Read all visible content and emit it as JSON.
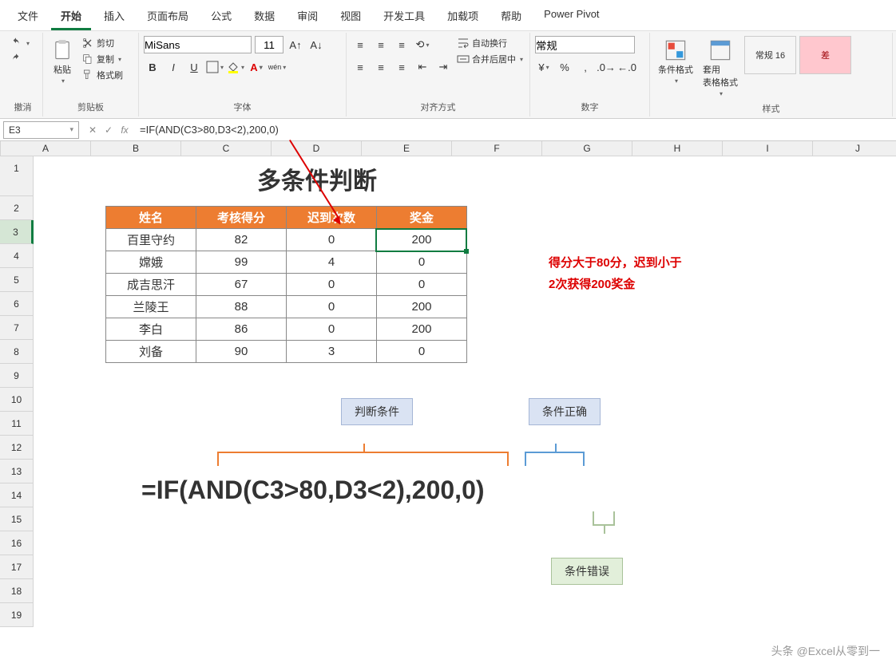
{
  "tabs": [
    "文件",
    "开始",
    "插入",
    "页面布局",
    "公式",
    "数据",
    "审阅",
    "视图",
    "开发工具",
    "加载项",
    "帮助",
    "Power Pivot"
  ],
  "active_tab": 1,
  "ribbon": {
    "undo_label": "撤消",
    "clipboard": {
      "paste": "粘贴",
      "cut": "剪切",
      "copy": "复制",
      "painter": "格式刷",
      "label": "剪贴板"
    },
    "font": {
      "name": "MiSans",
      "size": "11",
      "label": "字体",
      "bold": "B",
      "italic": "I",
      "underline": "U",
      "wen": "wén"
    },
    "align": {
      "label": "对齐方式",
      "wrap": "自动换行",
      "merge": "合并后居中"
    },
    "number": {
      "label": "数字",
      "fmt": "常规"
    },
    "styles": {
      "cond": "条件格式",
      "table": "套用\n表格格式",
      "chip1": "常规 16",
      "chip2": "差",
      "label": "样式"
    }
  },
  "cell_ref": "E3",
  "formula": "=IF(AND(C3>80,D3<2),200,0)",
  "sheet": {
    "cols": [
      "A",
      "B",
      "C",
      "D",
      "E",
      "F",
      "G",
      "H",
      "I",
      "J"
    ],
    "rows_count": 19,
    "title": "多条件判断",
    "headers": [
      "姓名",
      "考核得分",
      "迟到次数",
      "奖金"
    ],
    "data": [
      {
        "name": "百里守约",
        "score": 82,
        "late": 0,
        "bonus": 200
      },
      {
        "name": "嫦娥",
        "score": 99,
        "late": 4,
        "bonus": 0
      },
      {
        "name": "成吉思汗",
        "score": 67,
        "late": 0,
        "bonus": 0
      },
      {
        "name": "兰陵王",
        "score": 88,
        "late": 0,
        "bonus": 200
      },
      {
        "name": "李白",
        "score": 86,
        "late": 0,
        "bonus": 200
      },
      {
        "name": "刘备",
        "score": 90,
        "late": 3,
        "bonus": 0
      }
    ],
    "note1": "得分大于80分，迟到小于",
    "note2": "2次获得200奖金",
    "lbl_cond": "判断条件",
    "lbl_true": "条件正确",
    "lbl_false": "条件错误",
    "big_formula": "=IF(AND(C3>80,D3<2),200,0)"
  },
  "watermark": "头条 @Excel从零到一",
  "chart_data": {
    "type": "table",
    "title": "多条件判断",
    "columns": [
      "姓名",
      "考核得分",
      "迟到次数",
      "奖金"
    ],
    "rows": [
      [
        "百里守约",
        82,
        0,
        200
      ],
      [
        "嫦娥",
        99,
        4,
        0
      ],
      [
        "成吉思汗",
        67,
        0,
        0
      ],
      [
        "兰陵王",
        88,
        0,
        200
      ],
      [
        "李白",
        86,
        0,
        200
      ],
      [
        "刘备",
        90,
        3,
        0
      ]
    ],
    "formula": "=IF(AND(C3>80,D3<2),200,0)",
    "annotations": [
      "判断条件",
      "条件正确",
      "条件错误"
    ],
    "rule": "得分大于80分，迟到小于2次获得200奖金"
  }
}
